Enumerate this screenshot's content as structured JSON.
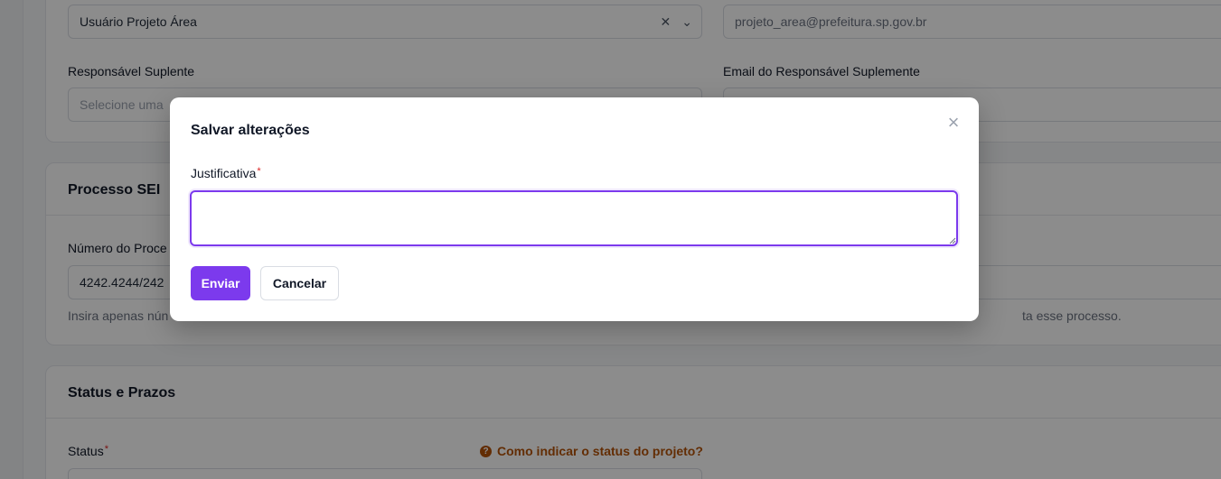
{
  "background": {
    "card1": {
      "responsavel_value": "Usuário Projeto Área",
      "email_value": "projeto_area@prefeitura.sp.gov.br",
      "suplente_label": "Responsável Suplente",
      "suplente_placeholder": "Selecione uma",
      "email_suplente_label": "Email do Responsável Suplemente"
    },
    "card2": {
      "title": "Processo SEI",
      "numero_label": "Número do Proce",
      "numero_value": "4242.4244/242",
      "help_left": "Insira apenas nún",
      "help_right": "ta esse processo."
    },
    "card3": {
      "title": "Status e Prazos",
      "status_label": "Status",
      "required_mark": "*",
      "hint_link": "Como indicar o status do projeto?",
      "hint_icon": "?"
    }
  },
  "modal": {
    "title": "Salvar alterações",
    "close_icon": "×",
    "field_label": "Justificativa",
    "required_mark": "*",
    "textarea_value": "",
    "submit_label": "Enviar",
    "cancel_label": "Cancelar"
  },
  "colors": {
    "accent": "#7c3aed",
    "required": "#dc2626",
    "hint": "#b45309"
  }
}
